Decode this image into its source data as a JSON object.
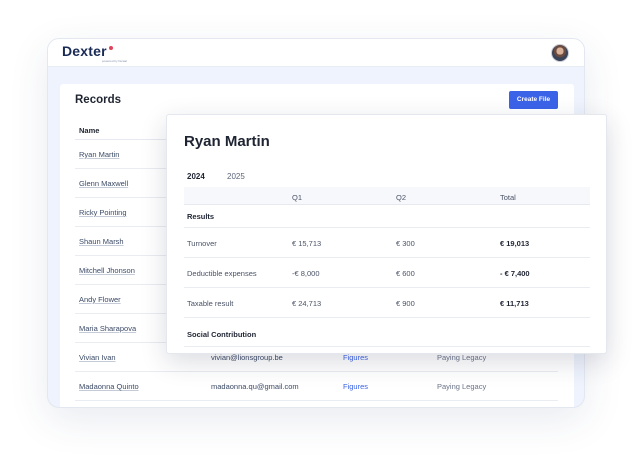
{
  "app": {
    "logo_text_a": "De",
    "logo_text_x": "x",
    "logo_text_b": "ter",
    "logo_tagline": "powered by fiscaal"
  },
  "records": {
    "title": "Records",
    "create_button": "Create File",
    "column_name": "Name",
    "rows": [
      {
        "name": "Ryan Martin",
        "email": "",
        "link": "",
        "status": ""
      },
      {
        "name": "Glenn Maxwell",
        "email": "",
        "link": "",
        "status": ""
      },
      {
        "name": "Ricky Pointing",
        "email": "",
        "link": "",
        "status": ""
      },
      {
        "name": "Shaun Marsh",
        "email": "",
        "link": "",
        "status": ""
      },
      {
        "name": "Mitchell Jhonson",
        "email": "",
        "link": "",
        "status": ""
      },
      {
        "name": "Andy Flower",
        "email": "",
        "link": "",
        "status": ""
      },
      {
        "name": "Maria Sharapova",
        "email": "",
        "link": "",
        "status": ""
      },
      {
        "name": "Vivian Ivan",
        "email": "vivian@lionsgroup.be",
        "link": "Figures",
        "status": "Paying Legacy"
      },
      {
        "name": "Madaonna Quinto",
        "email": "madaonna.qu@gmail.com",
        "link": "Figures",
        "status": "Paying Legacy"
      }
    ]
  },
  "detail": {
    "title": "Ryan Martin",
    "years": [
      "2024",
      "2025"
    ],
    "columns": [
      "Q1",
      "Q2",
      "Total"
    ],
    "section_results": "Results",
    "rows": [
      {
        "label": "Turnover",
        "q1": "€ 15,713",
        "q2": "€ 300",
        "total": "€ 19,013"
      },
      {
        "label": "Deductible expenses",
        "q1": "-€ 8,000",
        "q2": "€ 600",
        "total": "- € 7,400"
      },
      {
        "label": "Taxable result",
        "q1": "€ 24,713",
        "q2": "€ 900",
        "total": "€ 11,713"
      }
    ],
    "section_social": "Social Contribution"
  },
  "colors": {
    "accent": "#3b63e8",
    "window_bg": "#eef3fd",
    "logo_dot": "#e0445b"
  }
}
